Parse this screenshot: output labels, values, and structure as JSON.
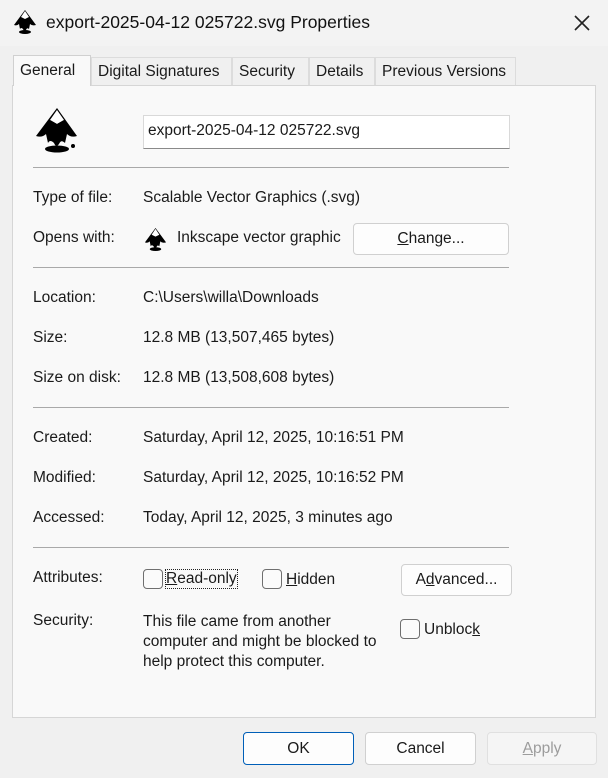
{
  "window": {
    "title": "export-2025-04-12 025722.svg Properties",
    "close_icon": "close-icon"
  },
  "tabs": [
    {
      "label": "General",
      "active": true
    },
    {
      "label": "Digital Signatures",
      "active": false
    },
    {
      "label": "Security",
      "active": false
    },
    {
      "label": "Details",
      "active": false
    },
    {
      "label": "Previous Versions",
      "active": false
    }
  ],
  "general": {
    "file_icon": "inkscape-icon",
    "file_name": "export-2025-04-12 025722.svg",
    "type_label": "Type of file:",
    "type_value": "Scalable Vector Graphics (.svg)",
    "opens_label": "Opens with:",
    "opens_value": "Inkscape vector graphic",
    "change_pre": "",
    "change_u": "C",
    "change_post": "hange...",
    "location_label": "Location:",
    "location_value": "C:\\Users\\willa\\Downloads",
    "size_label": "Size:",
    "size_value": "12.8 MB (13,507,465 bytes)",
    "disk_label": "Size on disk:",
    "disk_value": "12.8 MB (13,508,608 bytes)",
    "created_label": "Created:",
    "created_value": "Saturday, April 12, 2025, 10:16:51 PM",
    "modified_label": "Modified:",
    "modified_value": "Saturday, April 12, 2025, 10:16:52 PM",
    "accessed_label": "Accessed:",
    "accessed_value": "Today, April 12, 2025, 3 minutes ago",
    "attributes_label": "Attributes:",
    "readonly_u": "R",
    "readonly_post": "ead-only",
    "readonly_checked": false,
    "hidden_u": "H",
    "hidden_post": "idden",
    "hidden_checked": false,
    "advanced_pre": "A",
    "advanced_u": "d",
    "advanced_post": "vanced...",
    "security_label": "Security:",
    "security_line1": "This file came from another",
    "security_line2": "computer and might be blocked to",
    "security_line3": "help protect this computer.",
    "unblock_pre": "Unbloc",
    "unblock_u": "k",
    "unblock_checked": false
  },
  "footer": {
    "ok_label": "OK",
    "cancel_label": "Cancel",
    "apply_u": "A",
    "apply_post": "pply",
    "accent_color": "#005fb8"
  }
}
